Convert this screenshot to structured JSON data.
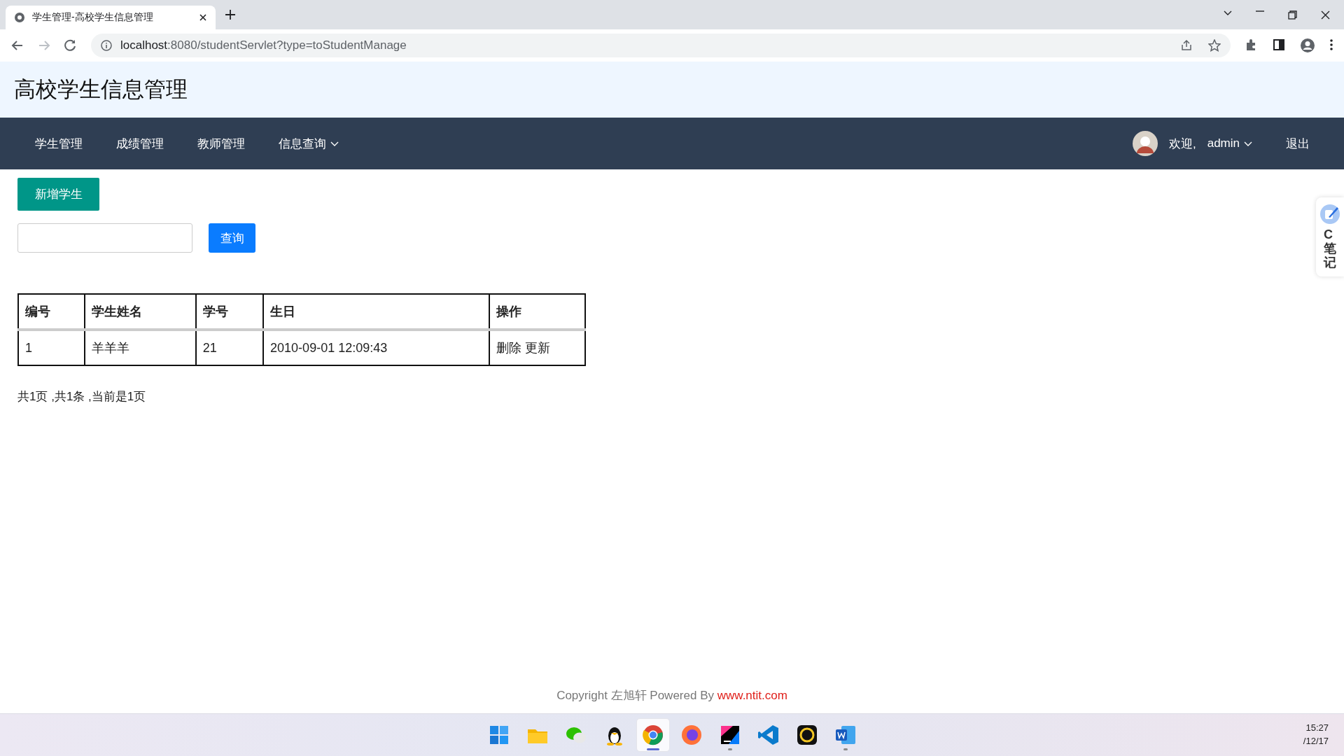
{
  "browser": {
    "tab_title": "学生管理-高校学生信息管理",
    "url_host": "localhost",
    "url_rest": ":8080/studentServlet?type=toStudentManage"
  },
  "header": {
    "title": "高校学生信息管理"
  },
  "nav": {
    "items": [
      {
        "label": "学生管理",
        "has_menu": false
      },
      {
        "label": "成绩管理",
        "has_menu": false
      },
      {
        "label": "教师管理",
        "has_menu": false
      },
      {
        "label": "信息查询",
        "has_menu": true
      }
    ],
    "welcome": "欢迎,",
    "user": "admin",
    "logout": "退出"
  },
  "actions": {
    "add_button": "新增学生",
    "search_button": "查询"
  },
  "table": {
    "columns": [
      "编号",
      "学生姓名",
      "学号",
      "生日",
      "操作"
    ],
    "rows": [
      {
        "cells": [
          "1",
          "羊羊羊",
          "21",
          "2010-09-01 12:09:43"
        ],
        "actions": [
          "删除",
          "更新"
        ]
      }
    ]
  },
  "pagination": "共1页 ,共1条 ,当前是1页",
  "side_widget": {
    "label": "C笔记"
  },
  "footer": {
    "text": "Copyright 左旭轩 Powered By",
    "link": "www.ntit.com"
  },
  "taskbar": {
    "apps": [
      {
        "selected": false,
        "running": false
      },
      {
        "selected": false,
        "running": false
      },
      {
        "selected": false,
        "running": false
      },
      {
        "selected": false,
        "running": false
      },
      {
        "selected": true,
        "running": true
      },
      {
        "selected": false,
        "running": false
      },
      {
        "selected": false,
        "running": true
      },
      {
        "selected": false,
        "running": false
      },
      {
        "selected": false,
        "running": false
      },
      {
        "selected": false,
        "running": true
      }
    ],
    "time": "15:27",
    "date": "/12/17"
  }
}
